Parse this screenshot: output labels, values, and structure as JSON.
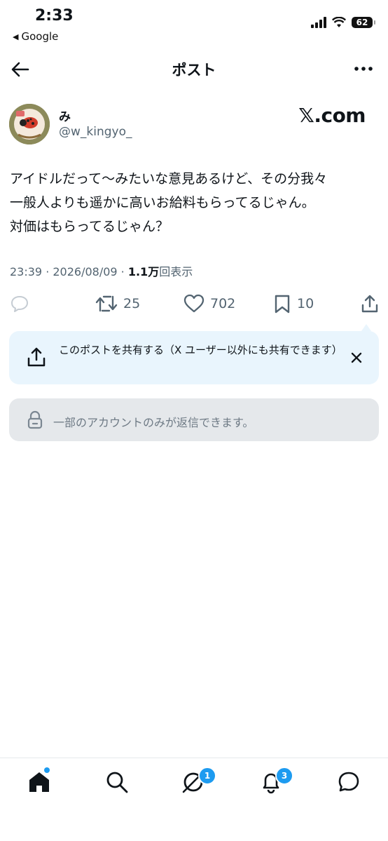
{
  "status_bar": {
    "time": "2:33",
    "back_app": "Google",
    "battery": "62"
  },
  "header": {
    "title": "ポスト"
  },
  "author": {
    "name": "み",
    "handle": "@w_kingyo_",
    "source_logo": "𝕏.com"
  },
  "post": {
    "lines": [
      "アイドルだって〜みたいな意見あるけど、その分我々",
      "一般人よりも遥かに高いお給料もらってるじゃん。",
      "対価はもらってるじゃん？"
    ],
    "time": "23:39 · 2026/08/09 · ",
    "views": "1.1万",
    "views_label": "回表示"
  },
  "actions": {
    "retweets": "25",
    "likes": "702",
    "bookmarks": "10"
  },
  "share_prompt": "このポストを共有する（X ユーザー以外にも共有できます）",
  "reply_restriction": "一部のアカウントのみが返信できます。",
  "nav": {
    "messages_badge": "1",
    "notifications_badge": "3"
  },
  "colors": {
    "accent": "#1d9bf0",
    "share_bg": "#e9f5fd",
    "reply_bg": "#e5e8eb",
    "muted": "#536471"
  }
}
